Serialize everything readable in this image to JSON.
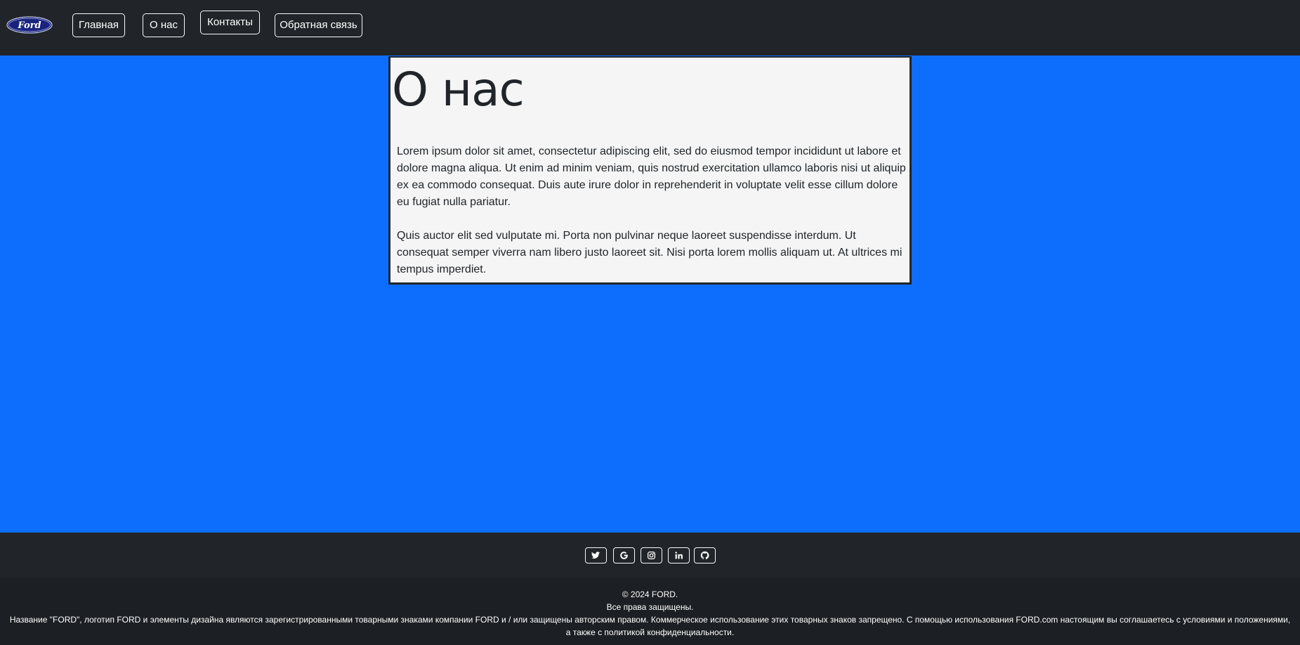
{
  "header": {
    "logo_text": "Ford",
    "nav": [
      {
        "label": "Главная"
      },
      {
        "label": "О нас"
      },
      {
        "label": "Контакты"
      },
      {
        "label": "Обратная связь"
      }
    ]
  },
  "main": {
    "title": "О нас",
    "paragraphs": [
      "Lorem ipsum dolor sit amet, consectetur adipiscing elit, sed do eiusmod tempor incididunt ut labore et dolore magna aliqua. Ut enim ad minim veniam, quis nostrud exercitation ullamco laboris nisi ut aliquip ex ea commodo consequat. Duis aute irure dolor in reprehenderit in voluptate velit esse cillum dolore eu fugiat nulla pariatur.",
      "Quis auctor elit sed vulputate mi. Porta non pulvinar neque laoreet suspendisse interdum. Ut consequat semper viverra nam libero justo laoreet sit. Nisi porta lorem mollis aliquam ut. At ultrices mi tempus imperdiet."
    ]
  },
  "footer": {
    "social": [
      {
        "icon": "twitter-icon"
      },
      {
        "icon": "google-icon"
      },
      {
        "icon": "instagram-icon"
      },
      {
        "icon": "linkedin-icon"
      },
      {
        "icon": "github-icon"
      }
    ],
    "copyright": "© 2024 FORD.",
    "rights": "Все права защищены.",
    "legal": "Название \"FORD\", логотип FORD и элементы дизайна являются зарегистрированными товарными знаками компании FORD и / или защищены авторским правом. Коммерческое использование этих товарных знаков запрещено. С помощью использования FORD.com настоящим вы соглашаетесь с условиями и положениями, а также с политикой конфиденциальности."
  },
  "colors": {
    "page_background": "#0d6efd",
    "navbar_background": "#212529",
    "card_background": "#f5f5f5",
    "footer_bottom_background": "#1c1f23",
    "logo_blue": "#1a237e"
  }
}
